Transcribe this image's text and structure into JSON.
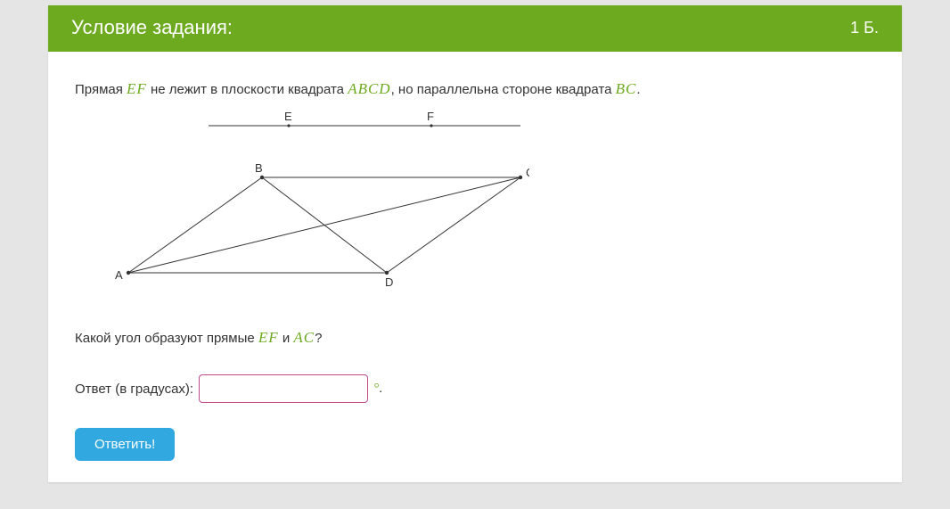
{
  "header": {
    "title": "Условие задания:",
    "score": "1 Б."
  },
  "problem": {
    "line1_a": "Прямая ",
    "line1_m1": "EF",
    "line1_b": " не лежит в плоскости квадрата ",
    "line1_m2": "ABCD",
    "line1_c": ", но параллельна стороне квадрата ",
    "line1_m3": "BC",
    "line1_d": ".",
    "line2_a": "Какой угол образуют прямые ",
    "line2_m1": "EF",
    "line2_b": " и ",
    "line2_m2": "AC",
    "line2_c": "?"
  },
  "figure": {
    "labels": {
      "A": "A",
      "B": "B",
      "C": "C",
      "D": "D",
      "E": "E",
      "F": "F"
    }
  },
  "answer": {
    "label": "Ответ (в градусах): ",
    "value": "",
    "degree": "°",
    "period": "."
  },
  "actions": {
    "submit": "Ответить!"
  }
}
